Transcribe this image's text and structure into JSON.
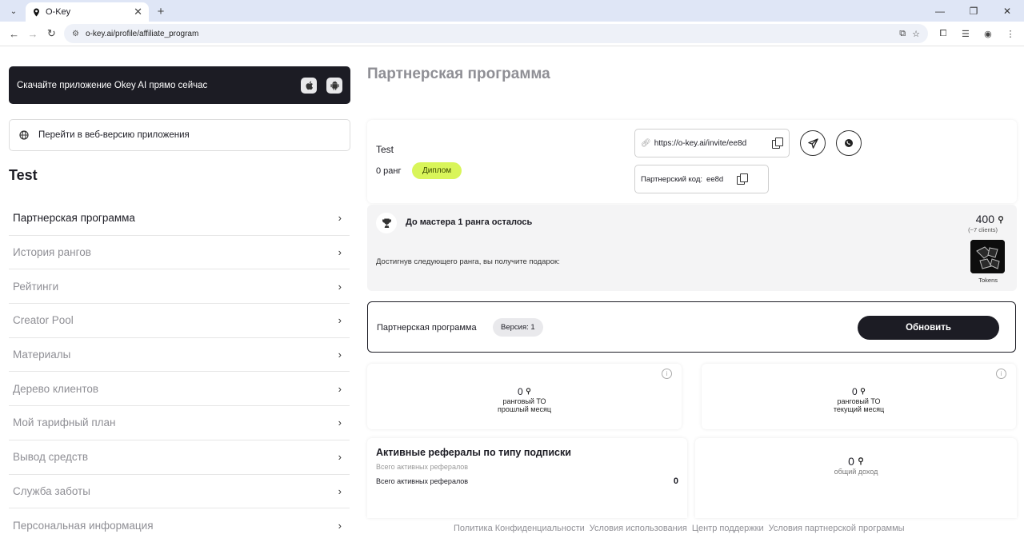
{
  "browser": {
    "tab_title": "O-Key",
    "url": "o-key.ai/profile/affiliate_program"
  },
  "sidebar": {
    "app_banner": "Скачайте приложение Okey AI прямо сейчас",
    "web_version": "Перейти в веб-версию приложения",
    "user_name": "Test",
    "items": [
      {
        "label": "Партнерская программа"
      },
      {
        "label": "История рангов"
      },
      {
        "label": "Рейтинги"
      },
      {
        "label": "Creator Pool"
      },
      {
        "label": "Материалы"
      },
      {
        "label": "Дерево клиентов"
      },
      {
        "label": "Мой тарифный план"
      },
      {
        "label": "Вывод средств"
      },
      {
        "label": "Служба заботы"
      },
      {
        "label": "Персональная информация"
      }
    ]
  },
  "main": {
    "title": "Партнерская программа",
    "profile": {
      "name": "Test",
      "rank": "0 ранг",
      "badge": "Диплом",
      "invite_link": "https://o-key.ai/invite/ee8d",
      "code_label": "Партнерский код:",
      "code_value": "ee8d"
    },
    "gift": {
      "title": "До мастера 1 ранга осталось",
      "subtitle": "Достигнув следующего ранга, вы получите подарок:",
      "amount": "400",
      "clients": "(~7 clients)",
      "reward_caption": "Tokens"
    },
    "version": {
      "label": "Партнерская программа",
      "badge": "Версия: 1",
      "button": "Обновить"
    },
    "stats": [
      {
        "value": "0",
        "line1": "ранговый ТО",
        "line2": "прошлый месяц"
      },
      {
        "value": "0",
        "line1": "ранговый ТО",
        "line2": "текущий месяц"
      }
    ],
    "referrals": {
      "title": "Активные рефералы по типу подписки",
      "subtitle": "Всего активных рефералов",
      "row_label": "Всего активных рефералов",
      "row_value": "0"
    },
    "income": {
      "value": "0",
      "label": "общий доход"
    }
  },
  "footer": {
    "links": [
      "Политика Конфиденциальности",
      "Условия использования",
      "Центр поддержки",
      "Условия партнерской программы"
    ]
  }
}
